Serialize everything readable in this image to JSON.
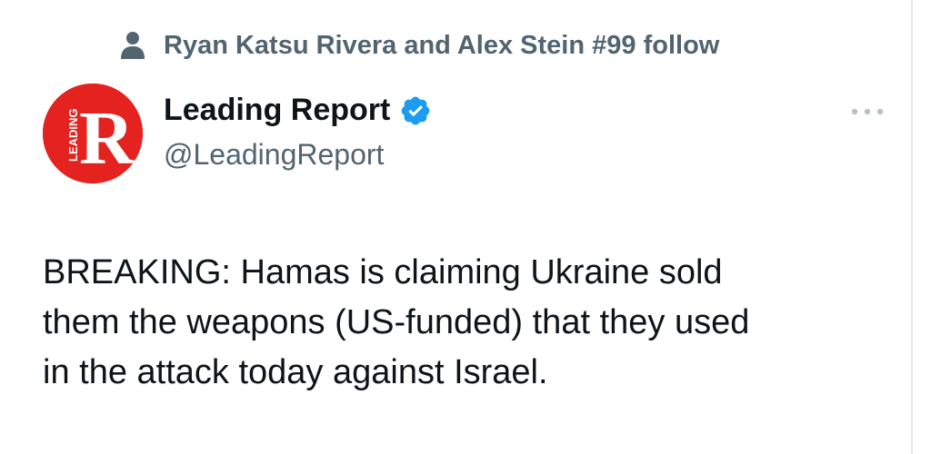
{
  "social_context": {
    "text": "Ryan Katsu Rivera and Alex Stein #99 follow",
    "icon": "person-icon"
  },
  "author": {
    "display_name": "Leading Report",
    "handle": "@LeadingReport",
    "verified": true,
    "verified_icon": "verified-badge-icon",
    "avatar_letter": "R",
    "avatar_text": "LEADING"
  },
  "more_menu": {
    "icon": "more-horizontal-icon"
  },
  "tweet": {
    "text": "BREAKING: Hamas is claiming Ukraine sold\nthem the weapons (US-funded) that they used\nin the attack today against Israel."
  },
  "colors": {
    "text_primary": "#0f1419",
    "text_secondary": "#536471",
    "verified_blue": "#1d9bf0",
    "avatar_red": "#e42320"
  }
}
